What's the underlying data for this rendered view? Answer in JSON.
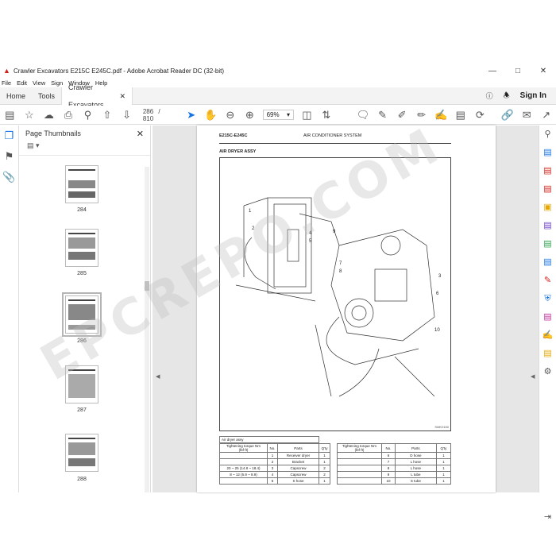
{
  "window": {
    "title": "Crawler Excavators E215C E245C.pdf - Adobe Acrobat Reader DC (32-bit)"
  },
  "menu": [
    "File",
    "Edit",
    "View",
    "Sign",
    "Window",
    "Help"
  ],
  "tabs": {
    "home": "Home",
    "tools": "Tools",
    "document": "Crawler Excavators ...",
    "signin": "Sign In"
  },
  "toolbar": {
    "current_page": "286",
    "separator": "/",
    "total_pages": "810",
    "zoom": "69%"
  },
  "thumbnails": {
    "title": "Page Thumbnails",
    "pages": [
      {
        "label": "284"
      },
      {
        "label": "285"
      },
      {
        "label": "286",
        "selected": true
      },
      {
        "label": "287"
      },
      {
        "label": "288"
      }
    ]
  },
  "document_page": {
    "header_left": "E215C-E245C",
    "header_right": "AIR CONDITIONER SYSTEM",
    "section_title": "AIR DRYER ASSY",
    "figure_code": "SMK0150",
    "callouts": [
      "1",
      "2",
      "3",
      "4",
      "5",
      "6",
      "7",
      "8",
      "9",
      "10"
    ],
    "table_caption": "Air dryer assy",
    "table_headers": {
      "torque": "Tightening torque Nm (lbf·ft)",
      "no": "No.",
      "parts": "Parts",
      "qty": "Q'ty"
    },
    "left_rows": [
      {
        "torque": "",
        "no": "1",
        "part": "Receiver dryer",
        "qty": "1"
      },
      {
        "torque": "",
        "no": "2",
        "part": "Bracket",
        "qty": "1"
      },
      {
        "torque": "20 ~ 25 (14.8 ~ 18.4)",
        "no": "3",
        "part": "Capscrew",
        "qty": "2"
      },
      {
        "torque": "8 ~ 12 (5.9 ~ 8.9)",
        "no": "4",
        "part": "Capscrew",
        "qty": "2"
      },
      {
        "torque": "",
        "no": "5",
        "part": "S hose",
        "qty": "1"
      }
    ],
    "right_rows": [
      {
        "torque": "",
        "no": "6",
        "part": "D hose",
        "qty": "1"
      },
      {
        "torque": "",
        "no": "7",
        "part": "L hose",
        "qty": "1"
      },
      {
        "torque": "",
        "no": "8",
        "part": "L hose",
        "qty": "1"
      },
      {
        "torque": "",
        "no": "9",
        "part": "L tube",
        "qty": "1"
      },
      {
        "torque": "",
        "no": "10",
        "part": "S tube",
        "qty": "1"
      }
    ]
  },
  "watermark": "EPCREPO.COM",
  "colors": {
    "accent": "#1473e6",
    "acrobat_red": "#d4201b"
  }
}
